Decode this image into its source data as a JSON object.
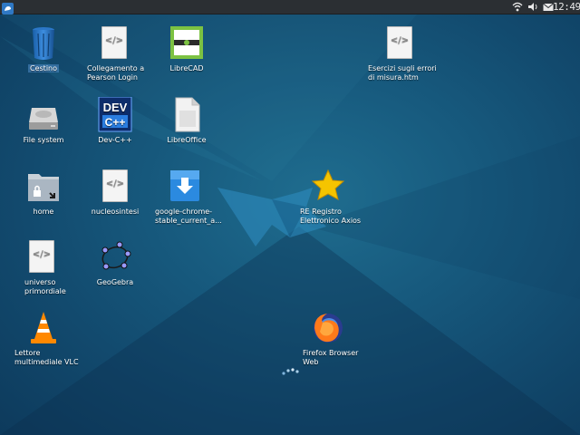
{
  "panel": {
    "menu_icon": "whisker-menu-icon",
    "tray": [
      "wifi-icon",
      "volume-icon",
      "mail-icon"
    ],
    "clock": "12:49"
  },
  "desktop": {
    "icons": [
      {
        "label": "Cestino",
        "icon": "trash-icon"
      },
      {
        "label": "Collegamento a Pearson Login",
        "icon": "html-file-icon"
      },
      {
        "label": "LibreCAD",
        "icon": "librecad-icon"
      },
      {
        "label": "Esercizi sugli errori di misura.htm",
        "icon": "html-file-icon"
      },
      {
        "label": "File system",
        "icon": "drive-icon"
      },
      {
        "label": "Dev-C++",
        "icon": "devcpp-icon"
      },
      {
        "label": "LibreOffice",
        "icon": "libreoffice-icon"
      },
      {
        "label": "home",
        "icon": "home-folder-icon"
      },
      {
        "label": "nucleosintesi",
        "icon": "html-file-icon"
      },
      {
        "label": "google-chrome-stable_current_a...",
        "icon": "download-package-icon"
      },
      {
        "label": "RE Registro Elettronico Axios",
        "icon": "star-icon"
      },
      {
        "label": "universo primordiale",
        "icon": "html-file-icon"
      },
      {
        "label": "GeoGebra",
        "icon": "geogebra-icon"
      },
      {
        "label": "Lettore multimediale VLC",
        "icon": "vlc-icon"
      },
      {
        "label": "Firefox Browser Web",
        "icon": "firefox-icon"
      }
    ]
  },
  "colors": {
    "panel": "#2b2f33",
    "desktop_dark": "#0d3a5c",
    "desktop_light": "#1f6d8f"
  }
}
